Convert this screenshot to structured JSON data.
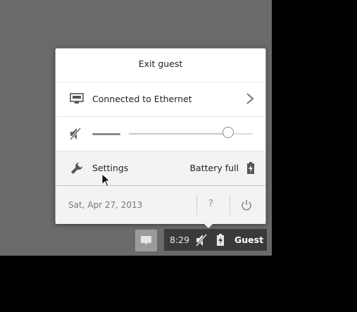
{
  "bubble": {
    "exit_guest": "Exit guest",
    "network": {
      "label": "Connected to Ethernet",
      "icon": "ethernet-icon"
    },
    "volume": {
      "muted": true,
      "level": 0.8,
      "icon": "volume-muted-icon"
    },
    "settings": {
      "label": "Settings",
      "battery_label": "Battery full",
      "icon": "wrench-icon"
    },
    "footer": {
      "date": "Sat, Apr 27, 2013",
      "help_label": "?",
      "power_icon": "power-icon"
    }
  },
  "shelf": {
    "time": "8:29",
    "user": "Guest",
    "notification_icon": "speech-bubble-icon"
  },
  "colors": {
    "desktop": "#6a6a6a",
    "tray": "#3a3a3a",
    "panel": "#ffffff",
    "panel_alt": "#f3f3f3"
  }
}
